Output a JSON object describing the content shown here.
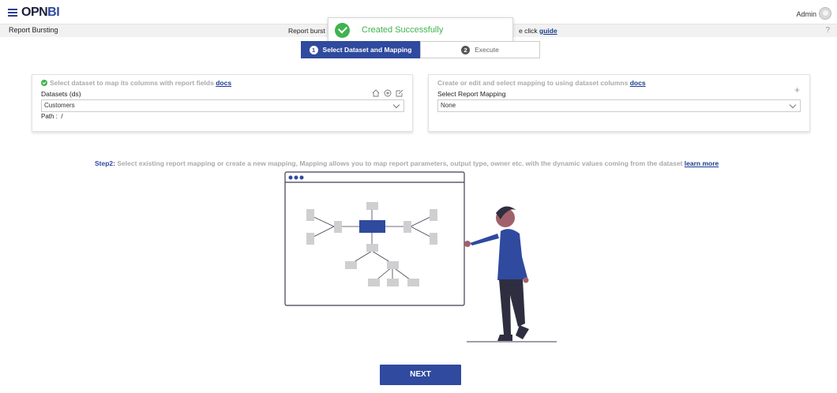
{
  "header": {
    "logo_prefix": "OPN",
    "logo_suffix": "BI",
    "user_name": "Admin"
  },
  "subheader": {
    "page_title": "Report Bursting",
    "info_text_left": "Report burst",
    "info_text_right": "e click",
    "guide_link": "guide",
    "help": "?"
  },
  "toast": {
    "message": "Created Successfully"
  },
  "stepper": {
    "steps": [
      {
        "number": "1",
        "label": "Select Dataset and Mapping",
        "active": true
      },
      {
        "number": "2",
        "label": "Execute",
        "active": false
      }
    ]
  },
  "dataset_card": {
    "heading": "Select dataset to map its columns with report fields",
    "docs_link": "docs",
    "field_label": "Datasets (ds)",
    "selected_value": "Customers",
    "path_label": "Path :",
    "path_value": "/"
  },
  "mapping_card": {
    "heading": "Create or edit and select mapping to using dataset columns",
    "docs_link": "docs",
    "field_label": "Select Report Mapping",
    "selected_value": "None"
  },
  "step2": {
    "label": "Step2:",
    "text": "Select existing report mapping or create a new mapping, Mapping allows you to map report parameters, output type, owner etc. with the dynamic values coming from the dataset",
    "learn_more_link": "learn more"
  },
  "actions": {
    "next_label": "NEXT"
  },
  "colors": {
    "primary": "#2f4a9e",
    "success": "#3fb34f"
  }
}
